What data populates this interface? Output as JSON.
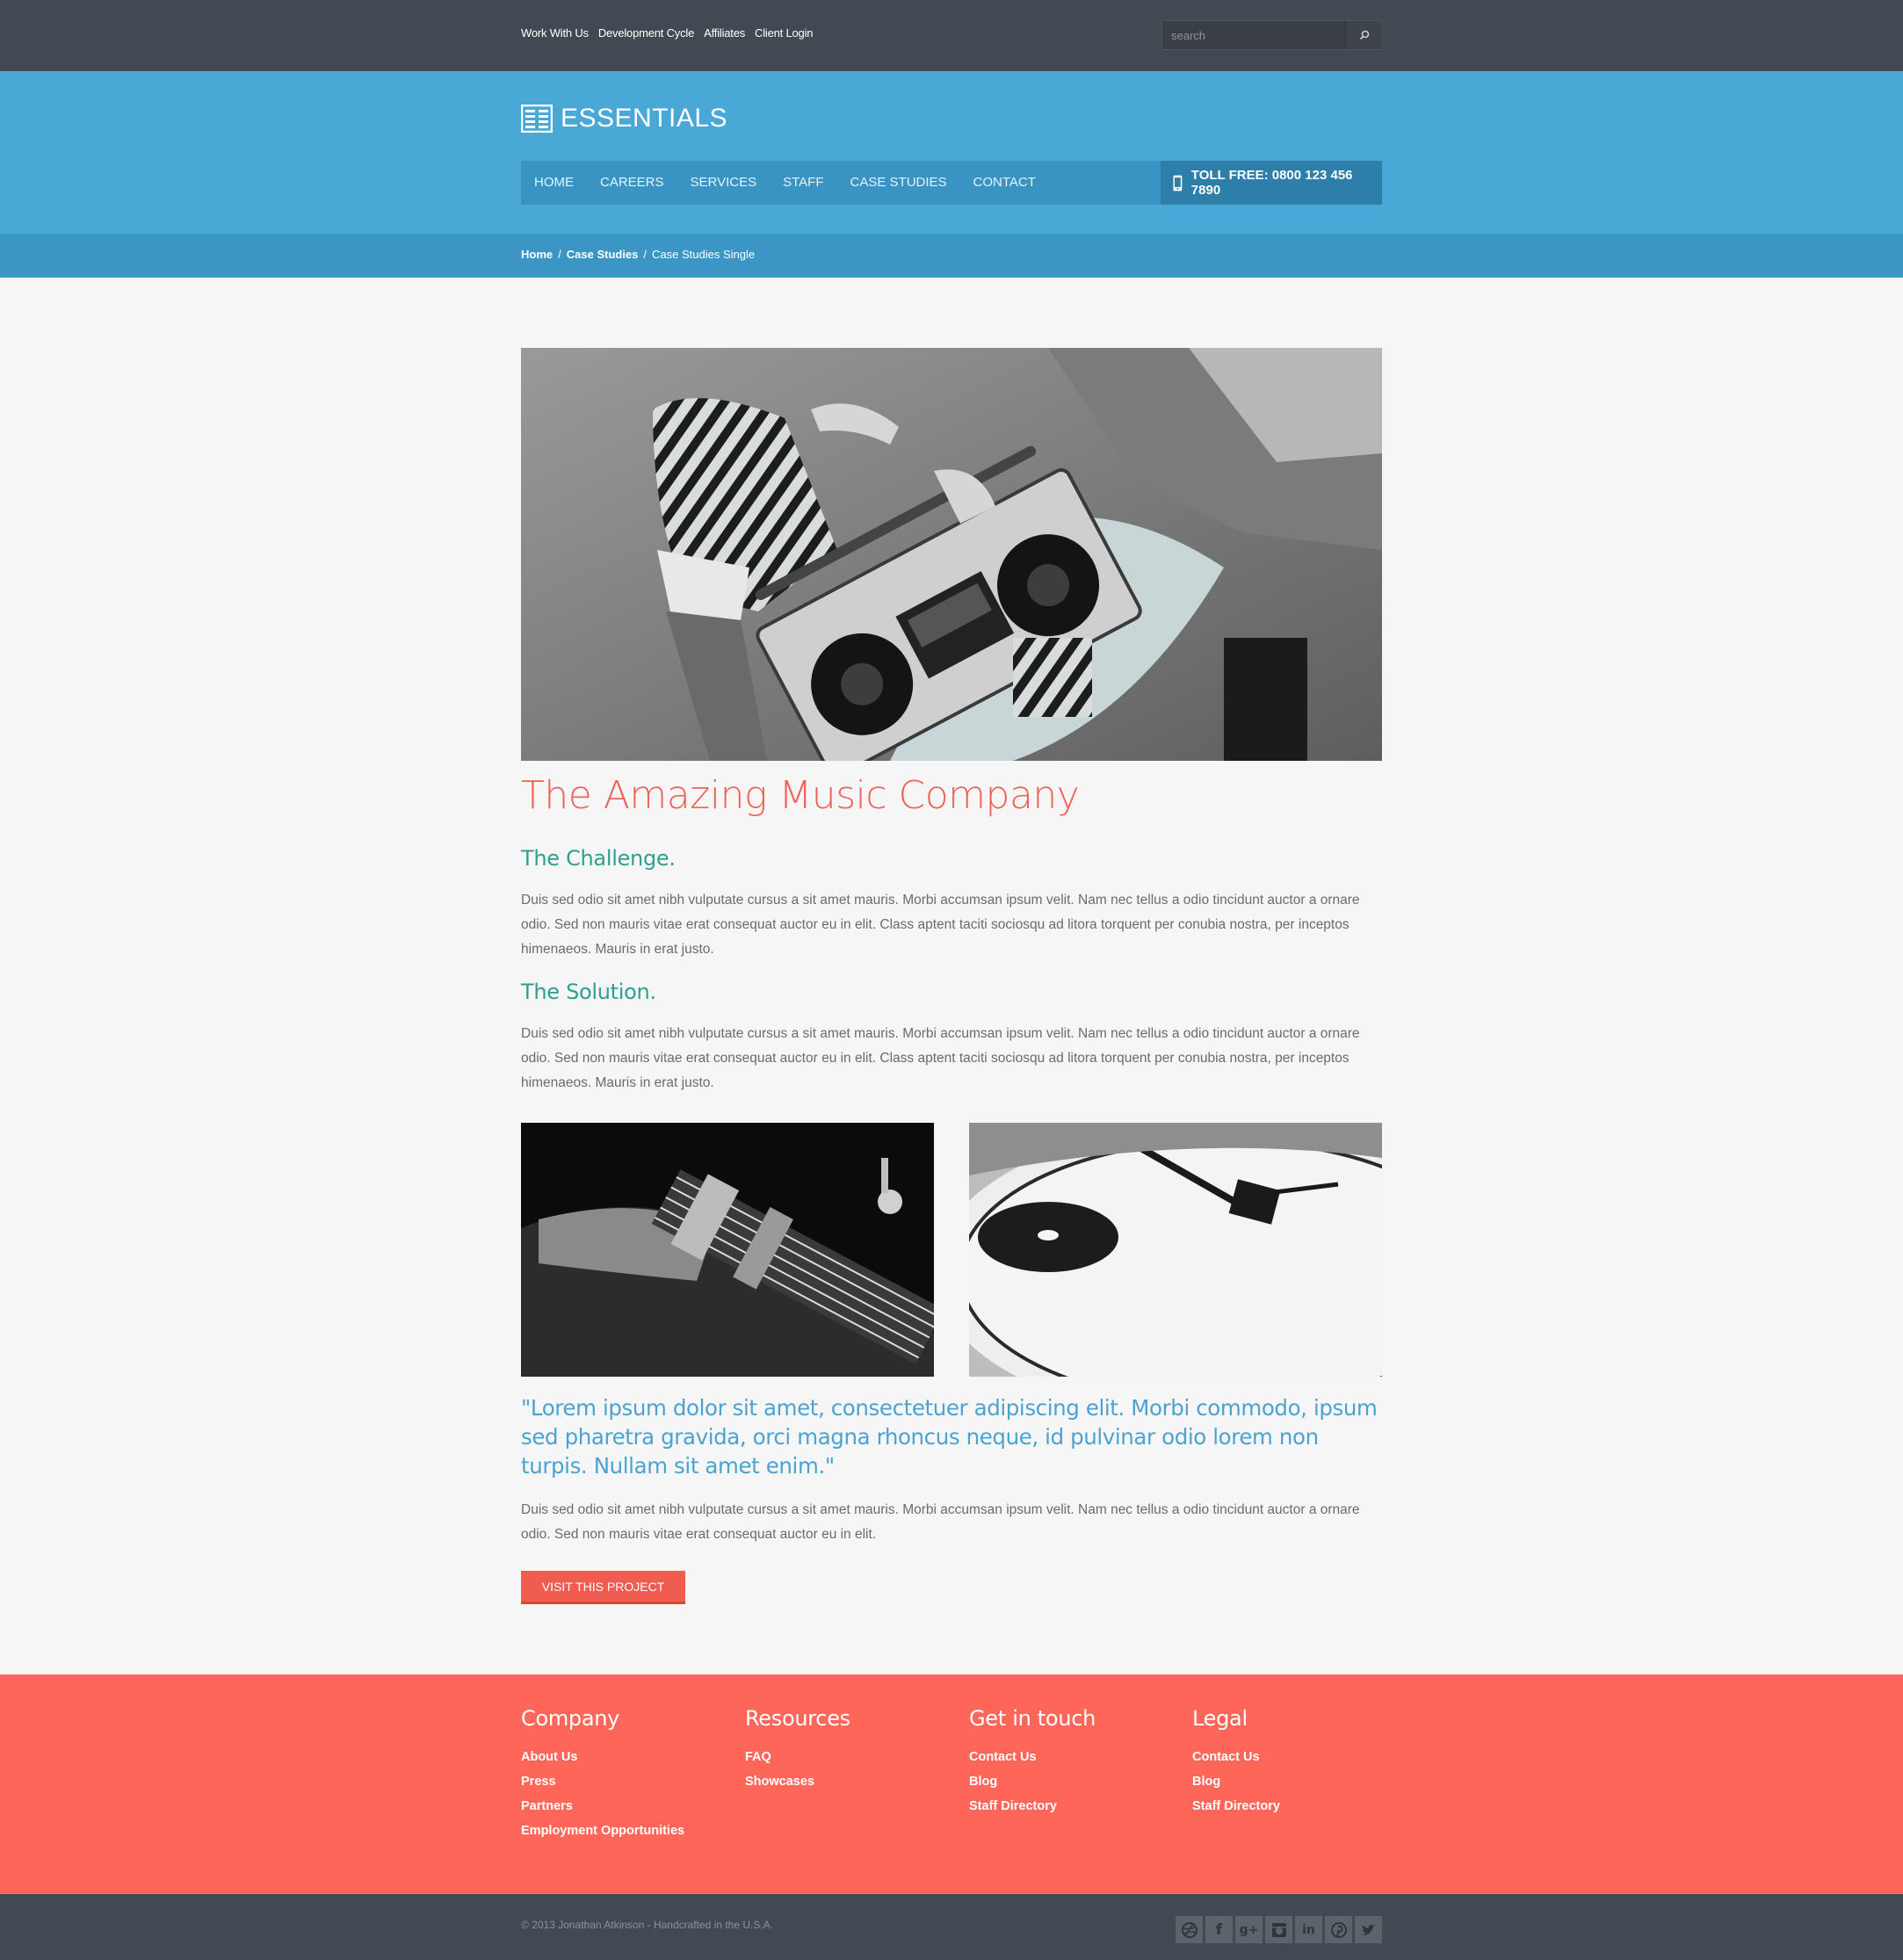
{
  "topbar": {
    "links": [
      "Work With Us",
      "Development Cycle",
      "Affiliates",
      "Client Login"
    ],
    "search_placeholder": "search"
  },
  "header": {
    "logo_text": "ESSENTIALS",
    "nav": [
      "HOME",
      "CAREERS",
      "SERVICES",
      "STAFF",
      "CASE STUDIES",
      "CONTACT"
    ],
    "tollfree": "TOLL FREE: 0800 123 456 7890"
  },
  "breadcrumb": {
    "home": "Home",
    "section": "Case Studies",
    "current": "Case Studies Single",
    "separator": "/"
  },
  "content": {
    "title": "The Amazing Music Company",
    "challenge_heading": "The Challenge.",
    "challenge_text": "Duis sed odio sit amet nibh vulputate cursus a sit amet mauris. Morbi accumsan ipsum velit. Nam nec tellus a odio tincidunt auctor a ornare odio. Sed non mauris vitae erat consequat auctor eu in elit. Class aptent taciti sociosqu ad litora torquent per conubia nostra, per inceptos himenaeos. Mauris in erat justo.",
    "solution_heading": "The Solution.",
    "solution_text": "Duis sed odio sit amet nibh vulputate cursus a sit amet mauris. Morbi accumsan ipsum velit. Nam nec tellus a odio tincidunt auctor a ornare odio. Sed non mauris vitae erat consequat auctor eu in elit. Class aptent taciti sociosqu ad litora torquent per conubia nostra, per inceptos himenaeos. Mauris in erat justo.",
    "quote": "\"Lorem ipsum dolor sit amet, consectetuer adipiscing elit. Morbi commodo, ipsum sed pharetra gravida, orci magna rhoncus neque, id pulvinar odio lorem non turpis. Nullam sit amet enim.\"",
    "closing_text": "Duis sed odio sit amet nibh vulputate cursus a sit amet mauris. Morbi accumsan ipsum velit. Nam nec tellus a odio tincidunt auctor a ornare odio. Sed non mauris vitae erat consequat auctor eu in elit.",
    "visit_button": "VISIT THIS PROJECT"
  },
  "footer": {
    "columns": [
      {
        "heading": "Company",
        "links": [
          "About Us",
          "Press",
          "Partners",
          "Employment Opportunities"
        ]
      },
      {
        "heading": "Resources",
        "links": [
          "FAQ",
          "Showcases"
        ]
      },
      {
        "heading": "Get in touch",
        "links": [
          "Contact Us",
          "Blog",
          "Staff Directory"
        ]
      },
      {
        "heading": "Legal",
        "links": [
          "Contact Us",
          "Blog",
          "Staff Directory"
        ]
      }
    ],
    "copyright": "© 2013 Jonathan Atkinson - Handcrafted in the U.S.A.",
    "socials": [
      "dribbble-icon",
      "facebook-icon",
      "google-plus-icon",
      "instagram-icon",
      "linkedin-icon",
      "pinterest-icon",
      "twitter-icon"
    ]
  },
  "colors": {
    "topbar": "#434952",
    "header_blue": "#4aa8d6",
    "accent_red": "#fe665a",
    "title_red": "#ef6258",
    "heading_green": "#2ea08e",
    "quote_blue": "#4aa3d3"
  }
}
